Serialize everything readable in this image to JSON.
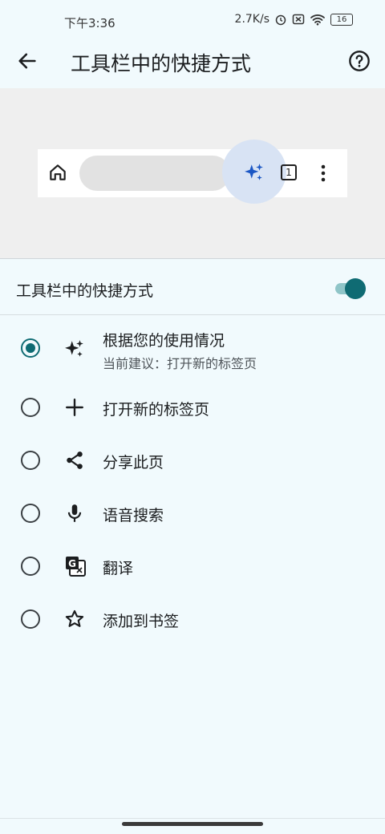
{
  "status_bar": {
    "time": "下午3:36",
    "speed": "2.7K/s",
    "battery": "16"
  },
  "header": {
    "title": "工具栏中的快捷方式"
  },
  "preview": {
    "tab_count": "1"
  },
  "toggle": {
    "label": "工具栏中的快捷方式",
    "enabled": true
  },
  "options": [
    {
      "label": "根据您的使用情况",
      "subtitle": "当前建议：打开新的标签页",
      "icon": "sparkle-icon",
      "selected": true
    },
    {
      "label": "打开新的标签页",
      "icon": "plus-icon",
      "selected": false
    },
    {
      "label": "分享此页",
      "icon": "share-icon",
      "selected": false
    },
    {
      "label": "语音搜索",
      "icon": "mic-icon",
      "selected": false
    },
    {
      "label": "翻译",
      "icon": "translate-icon",
      "selected": false
    },
    {
      "label": "添加到书签",
      "icon": "star-icon",
      "selected": false
    }
  ],
  "colors": {
    "accent": "#0f6b73",
    "background": "#f1fafd",
    "sparkle": "#1a56c4"
  }
}
